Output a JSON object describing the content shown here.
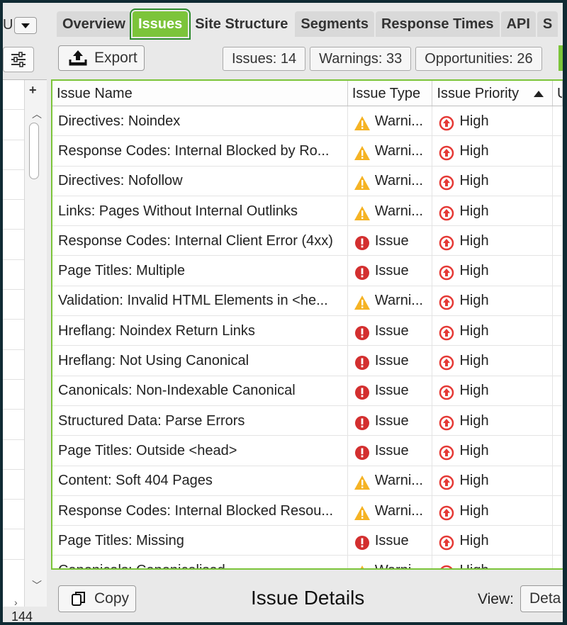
{
  "left": {
    "selector_text": "U",
    "row_count": "144"
  },
  "tabs": [
    {
      "label": "Overview",
      "active": false
    },
    {
      "label": "Issues",
      "active": true
    },
    {
      "label": "Site Structure",
      "active": false
    },
    {
      "label": "Segments",
      "active": false
    },
    {
      "label": "Response Times",
      "active": false
    },
    {
      "label": "API",
      "active": false
    },
    {
      "label": "S",
      "active": false
    }
  ],
  "toolbar": {
    "export_label": "Export",
    "issues_counter": "Issues: 14",
    "warnings_counter": "Warnings: 33",
    "opportunities_counter": "Opportunities: 26"
  },
  "table": {
    "headers": {
      "name": "Issue Name",
      "type": "Issue Type",
      "priority": "Issue Priority",
      "extra": "U"
    },
    "rows": [
      {
        "name": "Directives: Noindex",
        "type": "Warni...",
        "kind": "warning",
        "priority": "High"
      },
      {
        "name": "Response Codes: Internal Blocked by Ro...",
        "type": "Warni...",
        "kind": "warning",
        "priority": "High"
      },
      {
        "name": "Directives: Nofollow",
        "type": "Warni...",
        "kind": "warning",
        "priority": "High"
      },
      {
        "name": "Links: Pages Without Internal Outlinks",
        "type": "Warni...",
        "kind": "warning",
        "priority": "High"
      },
      {
        "name": "Response Codes: Internal Client Error (4xx)",
        "type": "Issue",
        "kind": "issue",
        "priority": "High"
      },
      {
        "name": "Page Titles: Multiple",
        "type": "Issue",
        "kind": "issue",
        "priority": "High"
      },
      {
        "name": "Validation: Invalid HTML Elements in <he...",
        "type": "Warni...",
        "kind": "warning",
        "priority": "High"
      },
      {
        "name": "Hreflang: Noindex Return Links",
        "type": "Issue",
        "kind": "issue",
        "priority": "High"
      },
      {
        "name": "Hreflang: Not Using Canonical",
        "type": "Issue",
        "kind": "issue",
        "priority": "High"
      },
      {
        "name": "Canonicals: Non-Indexable Canonical",
        "type": "Issue",
        "kind": "issue",
        "priority": "High"
      },
      {
        "name": "Structured Data: Parse Errors",
        "type": "Issue",
        "kind": "issue",
        "priority": "High"
      },
      {
        "name": "Page Titles: Outside <head>",
        "type": "Issue",
        "kind": "issue",
        "priority": "High"
      },
      {
        "name": "Content: Soft 404 Pages",
        "type": "Warni...",
        "kind": "warning",
        "priority": "High"
      },
      {
        "name": "Response Codes: Internal Blocked Resou...",
        "type": "Warni...",
        "kind": "warning",
        "priority": "High"
      },
      {
        "name": "Page Titles: Missing",
        "type": "Issue",
        "kind": "issue",
        "priority": "High"
      },
      {
        "name": "Canonicals: Canonicalised",
        "type": "Warni...",
        "kind": "warning",
        "priority": "High"
      }
    ]
  },
  "details": {
    "copy_label": "Copy",
    "title": "Issue Details",
    "view_label": "View:",
    "view_value": "Deta"
  },
  "colors": {
    "accent_green": "#7cc43a",
    "warning_yellow": "#f5b324",
    "issue_red": "#d32f2f",
    "priority_red": "#e53935"
  }
}
